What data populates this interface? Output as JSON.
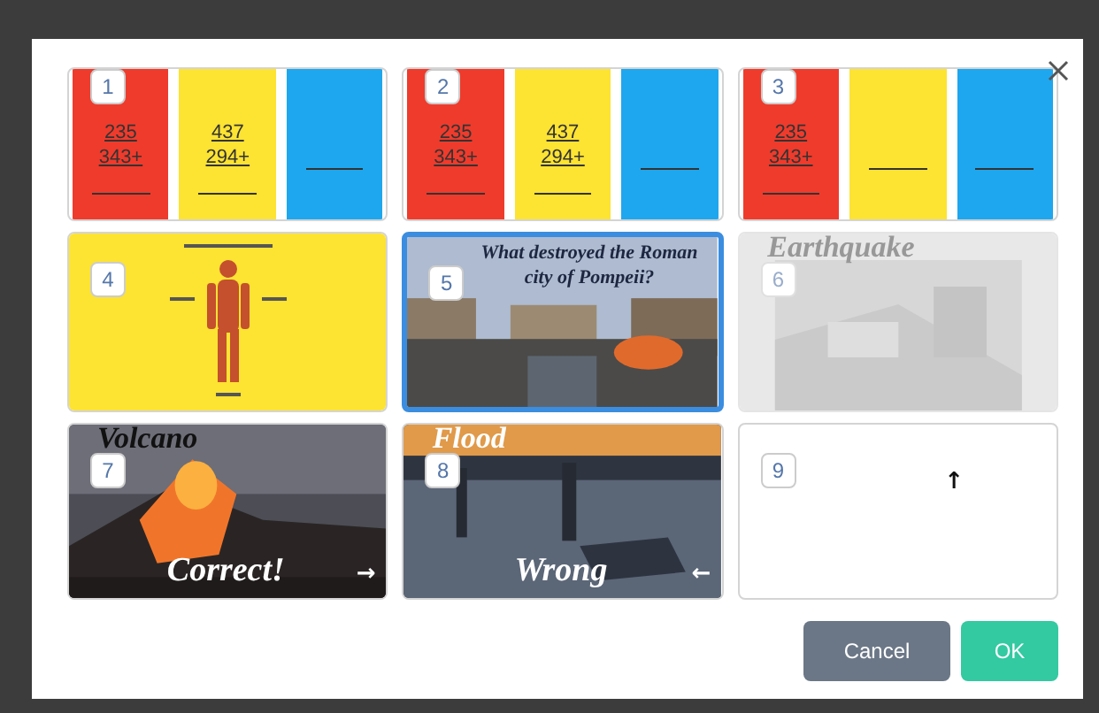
{
  "slides": [
    {
      "number": "1",
      "kind": "math",
      "selected": false,
      "faded": false,
      "columns": [
        {
          "color": "#ef3b2c",
          "lines": [
            "235",
            "343+"
          ]
        },
        {
          "color": "#fde332",
          "lines": [
            "437",
            "294+"
          ]
        },
        {
          "color": "#1ea7ee"
        }
      ]
    },
    {
      "number": "2",
      "kind": "math",
      "selected": false,
      "faded": false,
      "columns": [
        {
          "color": "#ef3b2c",
          "lines": [
            "235",
            "343+"
          ]
        },
        {
          "color": "#fde332",
          "lines": [
            "437",
            "294+"
          ]
        },
        {
          "color": "#1ea7ee"
        }
      ]
    },
    {
      "number": "3",
      "kind": "math",
      "selected": false,
      "faded": false,
      "columns": [
        {
          "color": "#ef3b2c",
          "lines": [
            "235",
            "343+"
          ]
        },
        {
          "color": "#fde332"
        },
        {
          "color": "#1ea7ee"
        }
      ]
    },
    {
      "number": "4",
      "kind": "body",
      "selected": false,
      "faded": false
    },
    {
      "number": "5",
      "selected": true,
      "faded": false,
      "title": "What destroyed the Roman city of Pompeii?"
    },
    {
      "number": "6",
      "selected": false,
      "faded": true,
      "heading": "Earthquake"
    },
    {
      "number": "7",
      "selected": false,
      "faded": false,
      "heading": "Volcano",
      "caption": "Correct!",
      "arrow": "→"
    },
    {
      "number": "8",
      "selected": false,
      "faded": false,
      "heading": "Flood",
      "caption": "Wrong",
      "arrow": "←"
    },
    {
      "number": "9",
      "kind": "blank",
      "selected": false,
      "faded": false,
      "arrow": "↑"
    }
  ],
  "buttons": [
    {
      "label": "Cancel",
      "kind": "secondary"
    },
    {
      "label": "OK",
      "kind": "primary"
    }
  ]
}
